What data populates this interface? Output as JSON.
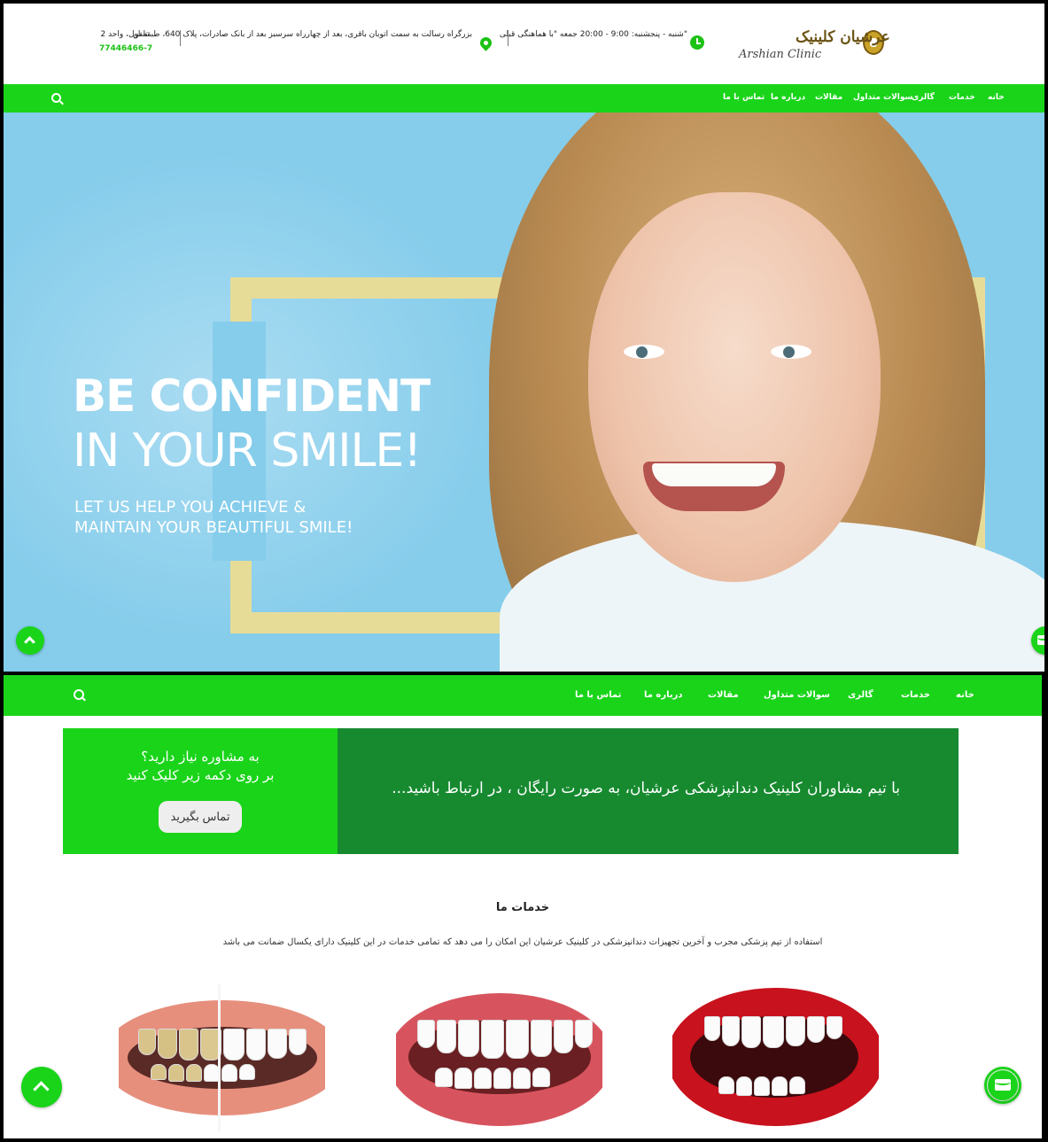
{
  "header": {
    "logo_fa": "عرشیان کلینیک",
    "logo_en": "Arshian Clinic",
    "hours": "\"شنبه - پنجشنبه: 9:00 - 20:00 جمعه \"با هماهنگی قبلی",
    "address": "بزرگراه رسالت به سمت اتوبان باقری، بعد از چهارراه سرسبز بعد از بانک صادرات، پلاک 640، طبقه اول، واحد 2",
    "phone_label": "تلفن",
    "phone": "77446466-7"
  },
  "nav": {
    "items": [
      "خانه",
      "خدمات",
      "گالری",
      "سوالات متداول",
      "مقالات",
      "درباره ما",
      "تماس با ما"
    ]
  },
  "hero": {
    "line1": "BE CONFIDENT",
    "line2": "IN YOUR SMILE!",
    "tagline1": "LET US HELP YOU ACHIEVE &",
    "tagline2": "MAINTAIN YOUR BEAUTIFUL SMILE!"
  },
  "cta": {
    "question_line1": "به مشاوره نیاز دارید؟",
    "question_line2": "بر روی دکمه زیر کلیک کنید",
    "button": "تماس بگیرید",
    "message": "با تیم مشاوران کلینیک دندانپزشکی عرشیان، به صورت رایگان ، در ارتباط باشید..."
  },
  "services": {
    "title": "خدمات ما",
    "description": "استفاده از تیم پزشکی مجرب و آخرین تجهیزات دندانپزشکی در کلینیک عرشیان این امکان را می دهد که تمامی خدمات در این کلینیک دارای یکسال ضمانت می باشد"
  },
  "colors": {
    "brand_green": "#1ad41a",
    "dark_green": "#178a30",
    "hero_sky": "#85cdeb",
    "frame_gold": "#e6dc98"
  },
  "icons": {
    "hours": "clock-icon",
    "address": "map-pin-icon",
    "search": "search-icon",
    "scroll_top": "chevron-up-icon",
    "contact": "envelope-icon"
  }
}
